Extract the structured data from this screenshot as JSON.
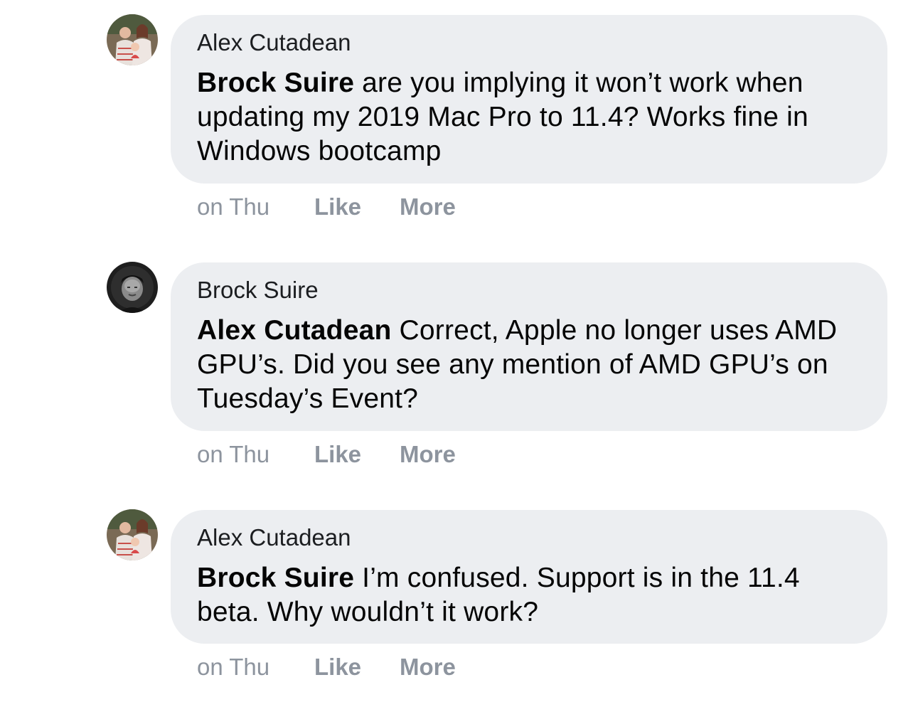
{
  "comments": [
    {
      "author": "Alex Cutadean",
      "mention": "Brock Suire",
      "text": " are you implying it won’t work when updating my 2019 Mac Pro to 11.4? Works fine in Windows bootcamp",
      "time": "on Thu",
      "like_label": "Like",
      "more_label": "More",
      "avatar_icon": "family-photo-avatar"
    },
    {
      "author": "Brock Suire",
      "mention": "Alex Cutadean",
      "text": " Correct, Apple no longer uses AMD GPU’s. Did you see any mention of AMD GPU’s on Tuesday’s Event?",
      "time": "on Thu",
      "like_label": "Like",
      "more_label": "More",
      "avatar_icon": "person-photo-avatar"
    },
    {
      "author": "Alex Cutadean",
      "mention": "Brock Suire",
      "text": " I’m confused. Support is in the 11.4 beta. Why wouldn’t it work?",
      "time": "on Thu",
      "like_label": "Like",
      "more_label": "More",
      "avatar_icon": "family-photo-avatar"
    }
  ],
  "colors": {
    "bubble": "#eceef1",
    "action_text": "#8d949e",
    "body_text": "#050505"
  }
}
